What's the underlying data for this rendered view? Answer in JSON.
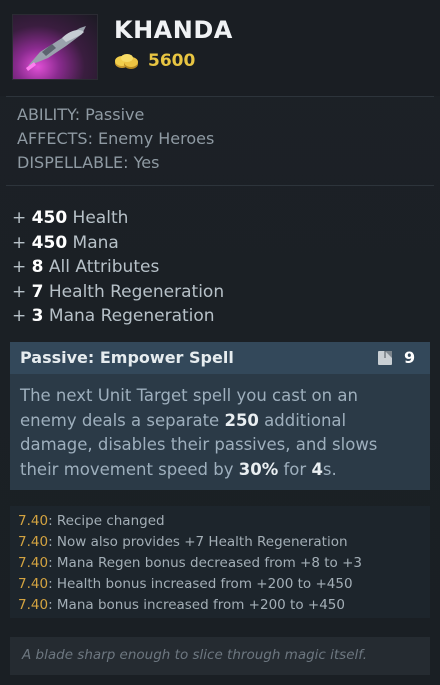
{
  "item": {
    "name": "KHANDA",
    "cost": "5600",
    "icon": "khanda-item-icon",
    "gold_icon": "gold-coins-icon"
  },
  "meta": {
    "ability": "ABILITY: Passive",
    "affects": "AFFECTS: Enemy Heroes",
    "dispellable": "DISPELLABLE: Yes"
  },
  "stats": [
    {
      "prefix": "+ ",
      "value": "450",
      "label": " Health"
    },
    {
      "prefix": "+ ",
      "value": "450",
      "label": " Mana"
    },
    {
      "prefix": "+ ",
      "value": "8",
      "label": " All Attributes"
    },
    {
      "prefix": "+ ",
      "value": "7",
      "label": " Health Regeneration"
    },
    {
      "prefix": "+ ",
      "value": "3",
      "label": " Mana Regeneration"
    }
  ],
  "ability": {
    "title": "Passive: Empower Spell",
    "cooldown_icon": "cooldown-icon",
    "cooldown": "9",
    "desc": {
      "p1": "The next Unit Target spell you cast on an enemy deals a separate ",
      "damage": "250",
      "p2": " additional damage, disables their passives, and slows their movement speed by ",
      "slow": "30%",
      "p3": " for ",
      "duration": "4",
      "p4": "s."
    }
  },
  "patch_notes": [
    {
      "version": "7.40",
      "text": ": Recipe changed"
    },
    {
      "version": "7.40",
      "text": ": Now also provides +7 Health Regeneration"
    },
    {
      "version": "7.40",
      "text": ": Mana Regen bonus decreased from +8 to +3"
    },
    {
      "version": "7.40",
      "text": ": Health bonus increased from +200 to +450"
    },
    {
      "version": "7.40",
      "text": ": Mana bonus increased from +200 to +450"
    }
  ],
  "lore": "A blade sharp enough to slice through magic itself.",
  "colors": {
    "gold": "#e8c542",
    "patch_version": "#d3a341",
    "ability_header": "#33485a",
    "ability_body": "#2b3a47"
  }
}
